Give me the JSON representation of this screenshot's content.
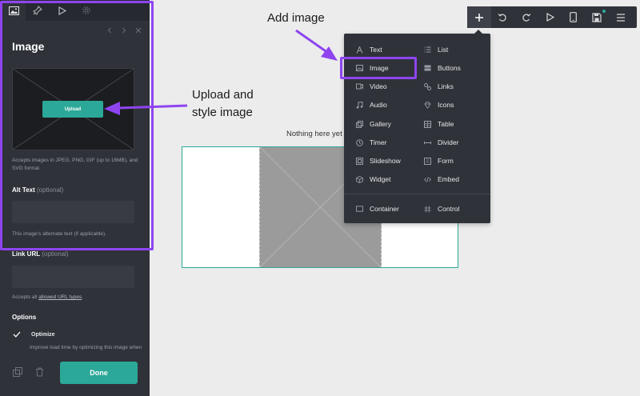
{
  "sidebar": {
    "tabs": [
      {
        "icon": "image-icon",
        "active": true
      },
      {
        "icon": "pin-icon",
        "active": false
      },
      {
        "icon": "play-icon",
        "active": false
      },
      {
        "icon": "gear-icon",
        "active": false
      }
    ],
    "title": "Image",
    "upload_label": "Upload",
    "accepts_text": "Accepts images in JPEG, PNG, GIF (up to 16MB), and SVG format.",
    "alt_text_label": "Alt Text",
    "alt_text_optional": "(optional)",
    "alt_text_help": "This image's alternate text (if applicable).",
    "link_url_label": "Link URL",
    "link_url_optional": "(optional)",
    "link_url_help_prefix": "Accepts all ",
    "link_url_help_link": "allowed URL types",
    "link_url_help_suffix": ".",
    "options_label": "Options",
    "optimize_label": "Optimize",
    "optimize_help": "Improve load time by optimizing this image when",
    "done_label": "Done"
  },
  "annotations": {
    "add_image": "Add image",
    "upload_line1": "Upload and",
    "upload_line2": "style image"
  },
  "canvas": {
    "empty_note": "Nothing here yet"
  },
  "menu": {
    "left": [
      "Text",
      "Image",
      "Video",
      "Audio",
      "Gallery",
      "Timer",
      "Slideshow",
      "Widget"
    ],
    "right": [
      "List",
      "Buttons",
      "Links",
      "Icons",
      "Table",
      "Divider",
      "Form",
      "Embed"
    ],
    "bottom_left": "Container",
    "bottom_right": "Control"
  },
  "colors": {
    "accent": "#2ca898",
    "highlight": "#8e45f0",
    "panel": "#2f3239"
  }
}
